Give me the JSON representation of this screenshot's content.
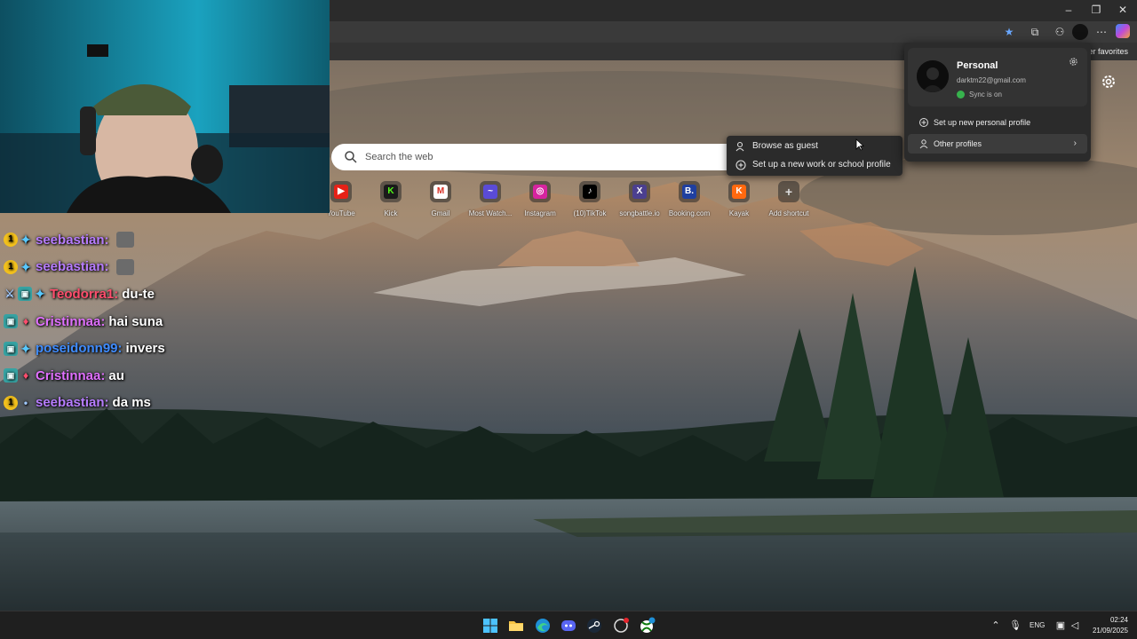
{
  "browser": {
    "favorites_overflow_label": "ther favorites",
    "search_placeholder": "Search the web",
    "shortcuts": [
      {
        "label": "YouTube",
        "icon": "youtube-icon",
        "color": "#e62117",
        "glyph": "▶"
      },
      {
        "label": "Kick",
        "icon": "kick-icon",
        "color": "#1a1a1a",
        "glyph": "K"
      },
      {
        "label": "Gmail",
        "icon": "gmail-icon",
        "color": "#ffffff",
        "glyph": "M"
      },
      {
        "label": "Most Watch...",
        "icon": "waveform-icon",
        "color": "#5a4bd6",
        "glyph": "~"
      },
      {
        "label": "Instagram",
        "icon": "instagram-icon",
        "color": "#d6249f",
        "glyph": "◎"
      },
      {
        "label": "(10)TikTok",
        "icon": "tiktok-icon",
        "color": "#000000",
        "glyph": "♪"
      },
      {
        "label": "songbattle.io",
        "icon": "songbattle-icon",
        "color": "#4b3f8f",
        "glyph": "X"
      },
      {
        "label": "Booking.com",
        "icon": "booking-icon",
        "color": "#1f3fa0",
        "glyph": "B."
      },
      {
        "label": "Kayak",
        "icon": "kayak-icon",
        "color": "#ff690f",
        "glyph": "K"
      },
      {
        "label": "Add shortcut",
        "icon": "plus-icon",
        "color": "#5a5a5a",
        "glyph": "+"
      }
    ]
  },
  "context_menu": {
    "items": [
      {
        "label": "Browse as guest",
        "icon": "guest-icon"
      },
      {
        "label": "Set up a new work or school profile",
        "icon": "add-circle-icon"
      }
    ]
  },
  "profile_flyout": {
    "name": "Personal",
    "email": "darktm22@gmail.com",
    "sync_status": "Sync is on",
    "setup_label": "Set up new personal profile",
    "other_label": "Other profiles"
  },
  "chat": {
    "messages": [
      {
        "badges": [
          "1",
          "mod"
        ],
        "user": "seebastian",
        "color": "#b77cff",
        "text": "",
        "emote": true
      },
      {
        "badges": [
          "1",
          "mod"
        ],
        "user": "seebastian",
        "color": "#b77cff",
        "text": "",
        "emote": true
      },
      {
        "badges": [
          "sword",
          "sub",
          "mod"
        ],
        "user": "Teodorra1",
        "color": "#ff4d6d",
        "text": "du-te",
        "emote": false
      },
      {
        "badges": [
          "sub",
          "heart"
        ],
        "user": "Cristinnaa",
        "color": "#e070ff",
        "text": "hai suna",
        "emote": false
      },
      {
        "badges": [
          "sub",
          "mod"
        ],
        "user": "poseidonn99",
        "color": "#3f8cff",
        "text": "invers",
        "emote": false
      },
      {
        "badges": [
          "sub",
          "heart"
        ],
        "user": "Cristinnaa",
        "color": "#e070ff",
        "text": "au",
        "emote": false
      },
      {
        "badges": [
          "1",
          "small"
        ],
        "user": "seebastian",
        "color": "#b77cff",
        "text": "da ms",
        "emote": false
      }
    ]
  },
  "taskbar": {
    "language": "ENG",
    "time": "02:24",
    "date": "21/09/2025",
    "apps": [
      "windows-start-icon",
      "file-explorer-icon",
      "edge-icon",
      "discord-icon",
      "steam-icon",
      "ea-app-icon",
      "xbox-icon"
    ]
  }
}
